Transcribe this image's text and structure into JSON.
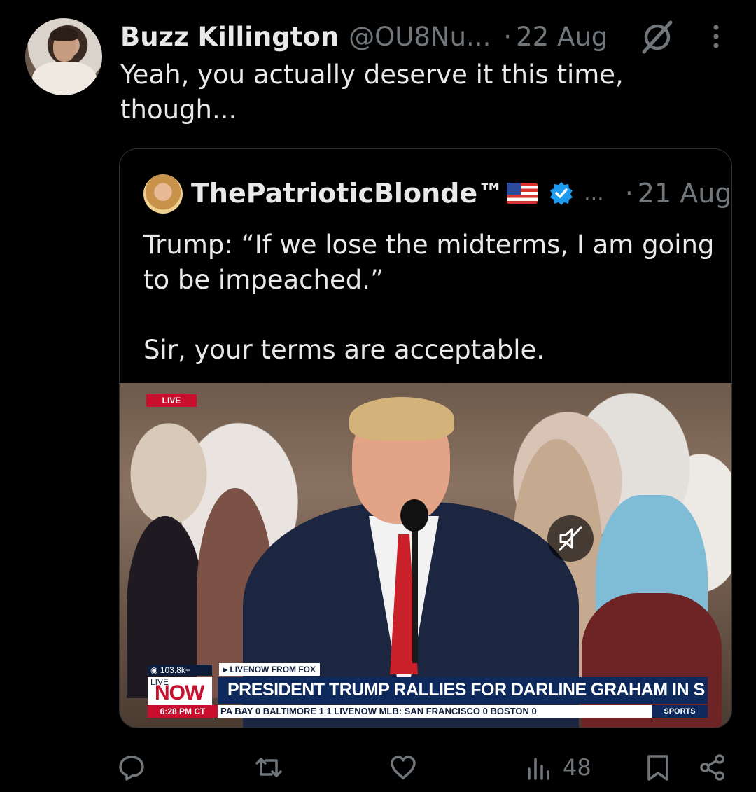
{
  "tweet": {
    "author_name": "Buzz Killington",
    "handle": "@OU8Nu...",
    "separator": "·",
    "date": "22 Aug",
    "text": "Yeah, you actually deserve it this time, though..."
  },
  "quoted": {
    "author_name": "ThePatrioticBlonde™",
    "ellipsis": "...",
    "separator": "·",
    "date": "21 Aug",
    "text": "Trump: “If we lose the midterms, I am going to be impeached.”\n\nSir, your terms are acceptable.",
    "media": {
      "live_tag": "LIVE",
      "views": "103.8k+",
      "source": "LIVENOW FROM FOX",
      "live_label_small": "LIVE",
      "live_label_big": "NOW",
      "headline": "PRESIDENT TRUMP RALLIES FOR DARLINE GRAHAM IN S",
      "time": "6:28 PM CT",
      "ticker": "PA BAY  0   BALTIMORE  1  1   LIVENOW   MLB:   SAN FRANCISCO  0   BOSTON  0",
      "sports": "SPORTS"
    }
  },
  "actions": {
    "reply_count": "",
    "retweet_count": "",
    "like_count": "",
    "views_count": "48"
  },
  "colors": {
    "background": "#000000",
    "text": "#e7e9ea",
    "muted": "#71767b",
    "border": "#2f3336",
    "verified": "#1d9bf0"
  }
}
